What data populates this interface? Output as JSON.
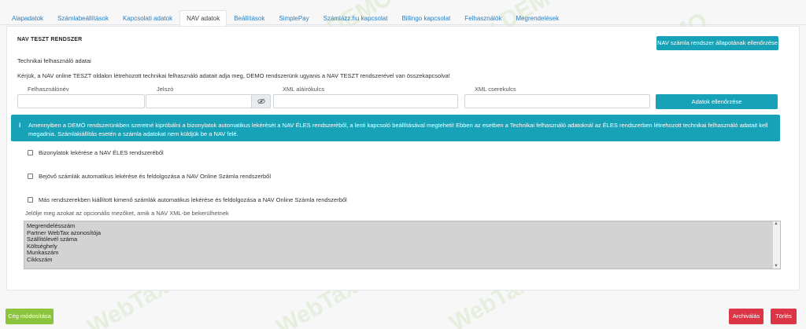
{
  "tabs": [
    "Alapadatok",
    "Számlabeállítások",
    "Kapcsolati adatok",
    "NAV adatok",
    "Beállítások",
    "SimplePay",
    "Számlázz.hu kapcsolat",
    "Billingo kapcsolat",
    "Felhasználók",
    "Megrendelések"
  ],
  "active_tab": "NAV adatok",
  "section": {
    "title": "NAV TESZT RENDSZER",
    "status_button": "NAV számla rendszer állapotának ellenőrzése",
    "subtitle": "Technikai felhasználó adatai",
    "description": "Kérjük, a NAV online TESZT oldalon létrehozott technikai felhasználó adatait adja meg, DEMO rendszerünk ugyanis a NAV TESZT rendszerével van összekapcsolva!"
  },
  "fields": {
    "username_label": "Felhasználónév",
    "password_label": "Jelszó",
    "xml_sign_label": "XML aláírókulcs",
    "xml_exchange_label": "XML cserekulcs",
    "check_button": "Adatok ellenőrzése"
  },
  "alert": {
    "icon": "i",
    "text": "Amennyiben a DEMÓ rendszerünkben szeretné kipróbálni a bizonylatok automatikus lekérését a NAV ÉLES rendszeréből, a lenti kapcsoló beállításával megteheti! Ebben az esetben a Technikai felhasználó adatoknál az ÉLES rendszerben létrehozott technikai felhasználó adatait kell megadnia. Számlakiállítás esetén a számla adatokat nem küldjük be a NAV felé."
  },
  "checkboxes": [
    "Bizonylatok lekérése a NAV ÉLES rendszeréből",
    "Bejövő számlák automatikus lekérése és feldolgozása a NAV Online Számla rendszerből",
    "Más rendszerekben kiállított kimenő számlák automatikus lekérése és feldolgozása a NAV Online Számla rendszerből"
  ],
  "optional_label": "Jelölje meg azokat az opcionális mezőket, amik a NAV XML-be bekerülhetnek",
  "optional_fields": [
    "Megrendelésszám",
    "Partner WebTax azonosítója",
    "Szállítólevél száma",
    "Költséghely",
    "Munkaszám",
    "Cikkszám"
  ],
  "footer": {
    "modify_button": "Cég módosítása",
    "archive_button": "Archiválás",
    "delete_button": "Törlés"
  },
  "watermark": "WebTax DEMO",
  "colors": {
    "accent": "#17a2b8",
    "green": "#8cc43e",
    "danger": "#dc3545",
    "link": "#2a7fc0"
  }
}
